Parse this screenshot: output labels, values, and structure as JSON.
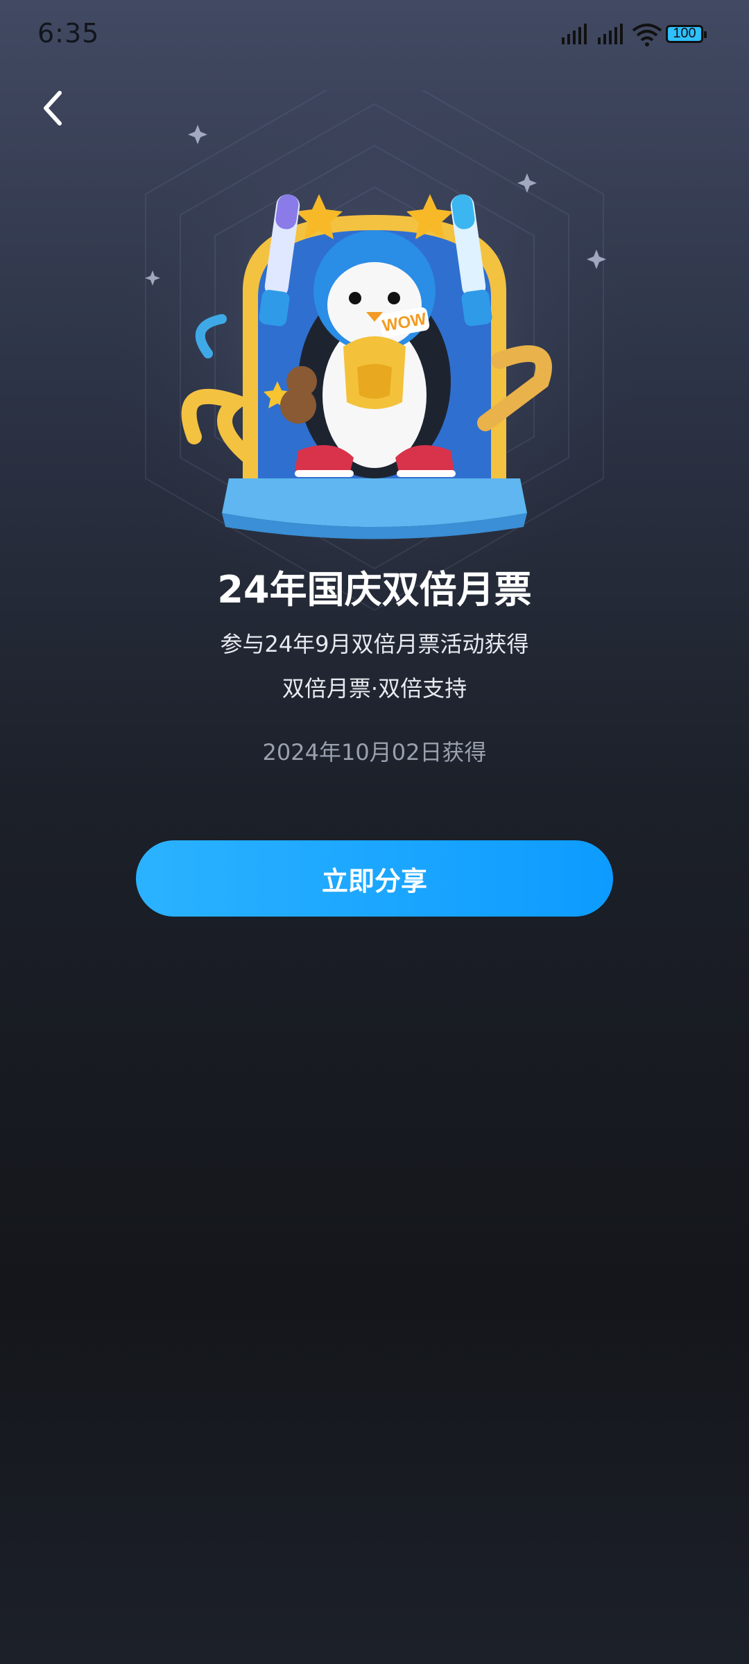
{
  "status_bar": {
    "time": "6:35",
    "battery": "100"
  },
  "badge": {
    "title": "24年国庆双倍月票",
    "description": "参与24年9月双倍月票活动获得",
    "tags": "双倍月票·双倍支持",
    "obtained_date": "2024年10月02日获得",
    "illustration_text": "WOW"
  },
  "actions": {
    "share_label": "立即分享"
  },
  "colors": {
    "accent": "#1aa7ff",
    "background_top": "#424a63",
    "background_bottom": "#14161b"
  }
}
